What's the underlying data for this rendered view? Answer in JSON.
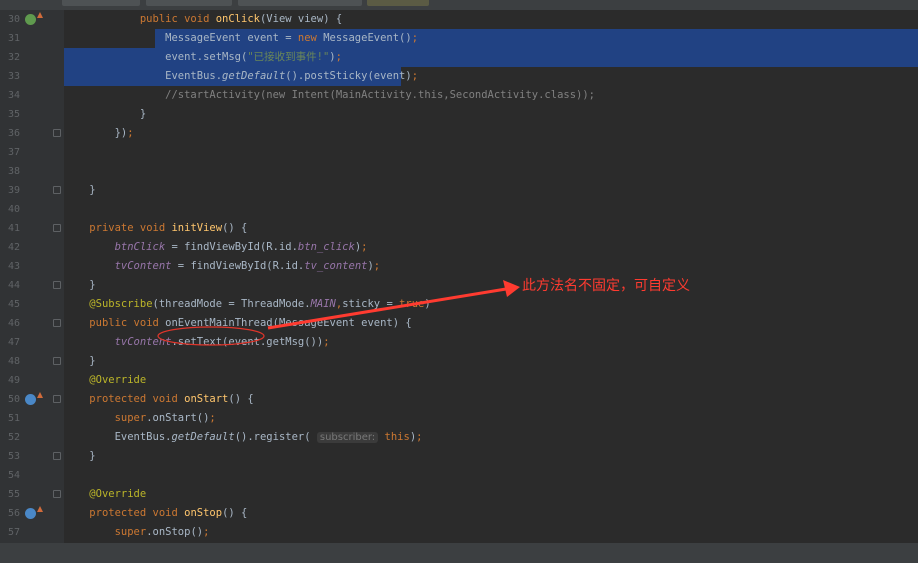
{
  "lines": [
    {
      "n": "30",
      "icon": "implements-icon",
      "fold": false,
      "hl": "none",
      "t": [
        {
          "c": "",
          "s": "            "
        },
        {
          "c": "k",
          "s": "public void "
        },
        {
          "c": "m",
          "s": "onClick"
        },
        {
          "c": "",
          "s": "(View view) {"
        }
      ]
    },
    {
      "n": "31",
      "fold": false,
      "hl": "partial",
      "t": [
        {
          "c": "",
          "s": "                MessageEvent event = "
        },
        {
          "c": "k",
          "s": "new "
        },
        {
          "c": "",
          "s": "MessageEvent()"
        },
        {
          "c": "k",
          "s": ";"
        }
      ]
    },
    {
      "n": "32",
      "fold": false,
      "hl": "full",
      "t": [
        {
          "c": "",
          "s": "                event.setMsg("
        },
        {
          "c": "s",
          "s": "\"已接收到事件!\""
        },
        {
          "c": "",
          "s": ")"
        },
        {
          "c": "k",
          "s": ";"
        }
      ]
    },
    {
      "n": "33",
      "fold": false,
      "hl": "full-partial",
      "t": [
        {
          "c": "",
          "s": "                EventBus."
        },
        {
          "c": "st",
          "s": "getDefault"
        },
        {
          "c": "",
          "s": "().postSticky(event)"
        },
        {
          "c": "k",
          "s": ";"
        }
      ]
    },
    {
      "n": "34",
      "fold": false,
      "hl": "none",
      "t": [
        {
          "c": "c",
          "s": "                //startActivity(new Intent(MainActivity.this,SecondActivity.class));"
        }
      ]
    },
    {
      "n": "35",
      "fold": false,
      "hl": "none",
      "t": [
        {
          "c": "",
          "s": "            }"
        }
      ]
    },
    {
      "n": "36",
      "fold": true,
      "hl": "none",
      "t": [
        {
          "c": "",
          "s": "        })"
        },
        {
          "c": "k",
          "s": ";"
        }
      ]
    },
    {
      "n": "37",
      "fold": false,
      "hl": "none",
      "t": []
    },
    {
      "n": "38",
      "fold": false,
      "hl": "none",
      "t": []
    },
    {
      "n": "39",
      "fold": true,
      "hl": "none",
      "t": [
        {
          "c": "",
          "s": "    }"
        }
      ]
    },
    {
      "n": "40",
      "fold": false,
      "hl": "none",
      "t": []
    },
    {
      "n": "41",
      "fold": true,
      "hl": "none",
      "t": [
        {
          "c": "",
          "s": "    "
        },
        {
          "c": "k",
          "s": "private void "
        },
        {
          "c": "m",
          "s": "initView"
        },
        {
          "c": "",
          "s": "() {"
        }
      ]
    },
    {
      "n": "42",
      "fold": false,
      "hl": "none",
      "t": [
        {
          "c": "",
          "s": "        "
        },
        {
          "c": "f",
          "s": "btnClick"
        },
        {
          "c": "",
          "s": " = findViewById(R.id."
        },
        {
          "c": "f",
          "s": "btn_click"
        },
        {
          "c": "",
          "s": ")"
        },
        {
          "c": "k",
          "s": ";"
        }
      ]
    },
    {
      "n": "43",
      "fold": false,
      "hl": "none",
      "t": [
        {
          "c": "",
          "s": "        "
        },
        {
          "c": "f",
          "s": "tvContent"
        },
        {
          "c": "",
          "s": " = findViewById(R.id."
        },
        {
          "c": "f",
          "s": "tv_content"
        },
        {
          "c": "",
          "s": ")"
        },
        {
          "c": "k",
          "s": ";"
        }
      ]
    },
    {
      "n": "44",
      "fold": true,
      "hl": "none",
      "t": [
        {
          "c": "",
          "s": "    }"
        }
      ]
    },
    {
      "n": "45",
      "fold": false,
      "hl": "none",
      "t": [
        {
          "c": "",
          "s": "    "
        },
        {
          "c": "a",
          "s": "@Subscribe"
        },
        {
          "c": "",
          "s": "(threadMode = ThreadMode."
        },
        {
          "c": "f",
          "s": "MAIN"
        },
        {
          "c": "k",
          "s": ","
        },
        {
          "c": "",
          "s": "sticky = "
        },
        {
          "c": "k",
          "s": "true"
        },
        {
          "c": "",
          "s": ")"
        }
      ]
    },
    {
      "n": "46",
      "fold": true,
      "hl": "none",
      "t": [
        {
          "c": "",
          "s": "    "
        },
        {
          "c": "k",
          "s": "public void "
        },
        {
          "c": "",
          "s": "onEventMainThread(MessageEvent event) {"
        }
      ]
    },
    {
      "n": "47",
      "fold": false,
      "hl": "none",
      "t": [
        {
          "c": "",
          "s": "        "
        },
        {
          "c": "f",
          "s": "tvContent"
        },
        {
          "c": "",
          "s": ".setText(event.getMsg())"
        },
        {
          "c": "k",
          "s": ";"
        }
      ]
    },
    {
      "n": "48",
      "fold": true,
      "hl": "none",
      "t": [
        {
          "c": "",
          "s": "    }"
        }
      ]
    },
    {
      "n": "49",
      "fold": false,
      "hl": "none",
      "t": [
        {
          "c": "",
          "s": "    "
        },
        {
          "c": "a",
          "s": "@Override"
        }
      ]
    },
    {
      "n": "50",
      "icon": "overrides-icon",
      "fold": true,
      "hl": "none",
      "t": [
        {
          "c": "",
          "s": "    "
        },
        {
          "c": "k",
          "s": "protected void "
        },
        {
          "c": "m",
          "s": "onStart"
        },
        {
          "c": "",
          "s": "() {"
        }
      ]
    },
    {
      "n": "51",
      "fold": false,
      "hl": "none",
      "t": [
        {
          "c": "",
          "s": "        "
        },
        {
          "c": "k",
          "s": "super"
        },
        {
          "c": "",
          "s": ".onStart()"
        },
        {
          "c": "k",
          "s": ";"
        }
      ]
    },
    {
      "n": "52",
      "fold": false,
      "hl": "none",
      "t": [
        {
          "c": "",
          "s": "        EventBus."
        },
        {
          "c": "st",
          "s": "getDefault"
        },
        {
          "c": "",
          "s": "().register( "
        },
        {
          "c": "hint",
          "s": "subscriber:"
        },
        {
          "c": "",
          "s": " "
        },
        {
          "c": "k",
          "s": "this"
        },
        {
          "c": "",
          "s": ")"
        },
        {
          "c": "k",
          "s": ";"
        }
      ]
    },
    {
      "n": "53",
      "fold": true,
      "hl": "none",
      "t": [
        {
          "c": "",
          "s": "    }"
        }
      ]
    },
    {
      "n": "54",
      "fold": false,
      "hl": "none",
      "t": []
    },
    {
      "n": "55",
      "fold": true,
      "hl": "none",
      "t": [
        {
          "c": "",
          "s": "    "
        },
        {
          "c": "a",
          "s": "@Override"
        }
      ]
    },
    {
      "n": "56",
      "icon": "overrides-icon",
      "fold": false,
      "hl": "none",
      "t": [
        {
          "c": "",
          "s": "    "
        },
        {
          "c": "k",
          "s": "protected void "
        },
        {
          "c": "m",
          "s": "onStop"
        },
        {
          "c": "",
          "s": "() {"
        }
      ]
    },
    {
      "n": "57",
      "fold": false,
      "hl": "none",
      "t": [
        {
          "c": "",
          "s": "        "
        },
        {
          "c": "k",
          "s": "super"
        },
        {
          "c": "",
          "s": ".onStop()"
        },
        {
          "c": "k",
          "s": ";"
        }
      ]
    }
  ],
  "annotation": {
    "text": "此方法名不固定，可自定义",
    "color": "#ff3b30"
  },
  "colors": {
    "selection": "#214283",
    "keyword": "#cc7832",
    "annotation_tag": "#bbb529",
    "string": "#6a8759",
    "method": "#ffc66d",
    "field": "#9876aa",
    "comment": "#808080"
  }
}
